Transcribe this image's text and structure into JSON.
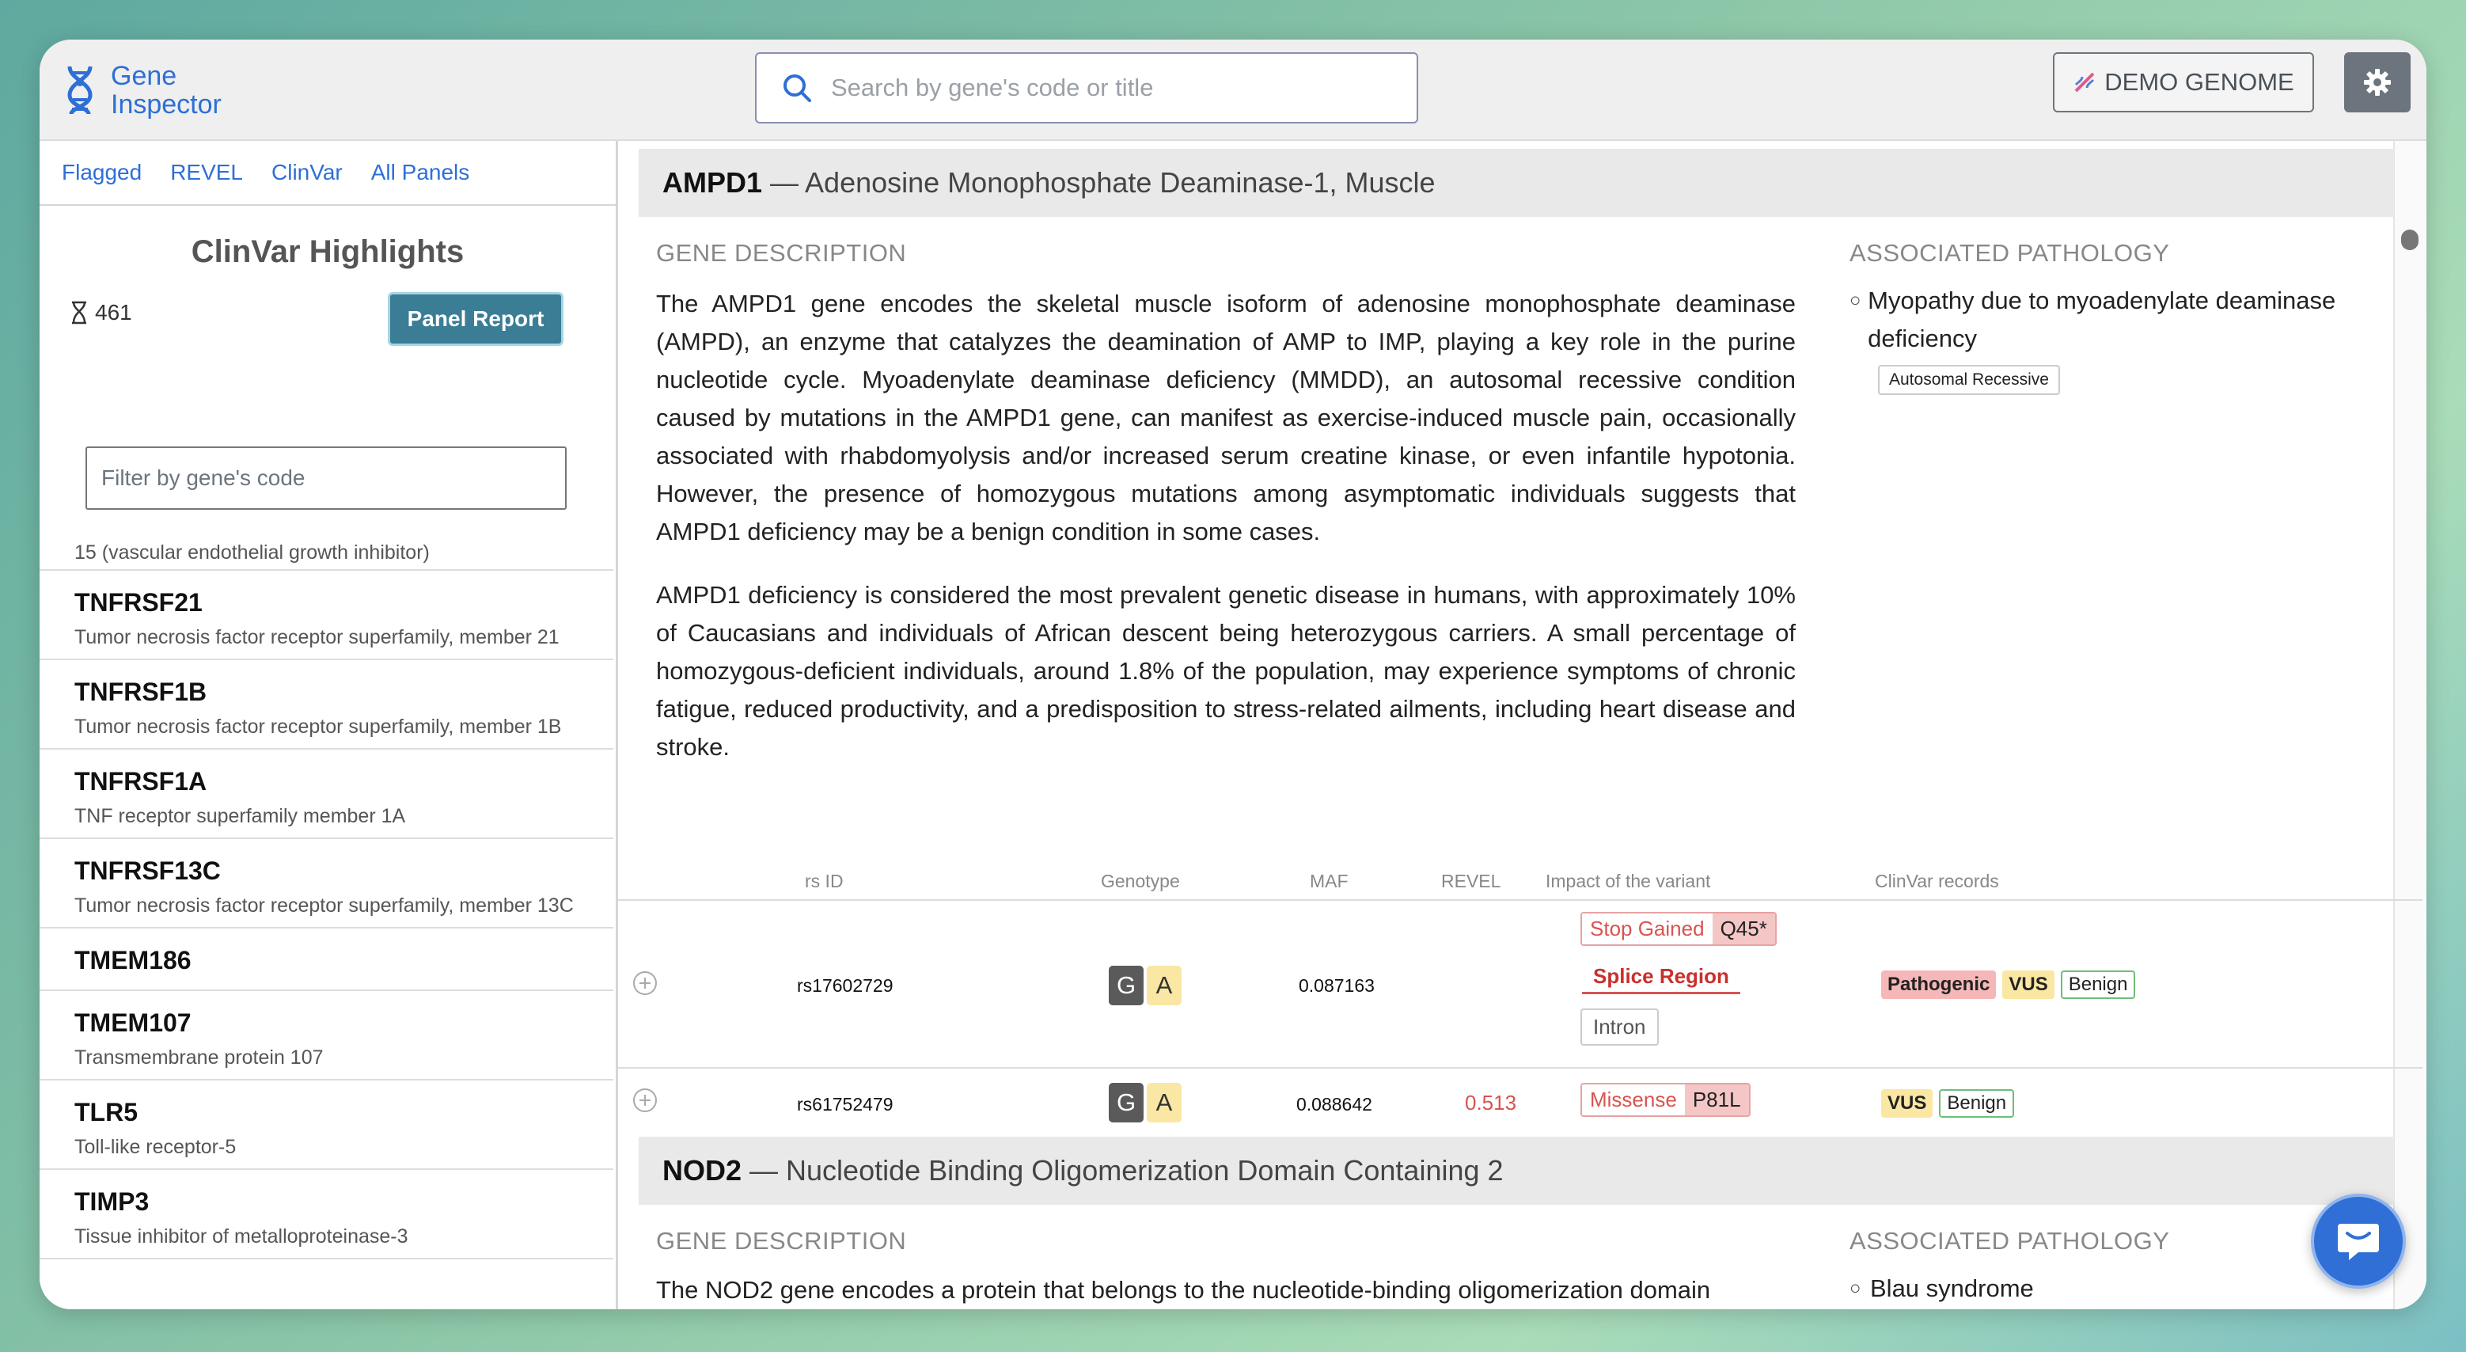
{
  "app": {
    "name_line1": "Gene",
    "name_line2": "Inspector"
  },
  "search": {
    "placeholder": "Search by gene's code or title"
  },
  "header": {
    "demo_label": "DEMO GENOME"
  },
  "sidebar": {
    "tabs": [
      "Flagged",
      "REVEL",
      "ClinVar",
      "All Panels"
    ],
    "title": "ClinVar Highlights",
    "count": "461",
    "panel_report": "Panel Report",
    "filter_placeholder": "Filter by gene's code",
    "cut_item": "15 (vascular endothelial growth inhibitor)",
    "genes": [
      {
        "code": "TNFRSF21",
        "name": "Tumor necrosis factor receptor superfamily, member 21"
      },
      {
        "code": "TNFRSF1B",
        "name": "Tumor necrosis factor receptor superfamily, member 1B"
      },
      {
        "code": "TNFRSF1A",
        "name": "TNF receptor superfamily member 1A"
      },
      {
        "code": "TNFRSF13C",
        "name": "Tumor necrosis factor receptor superfamily, member 13C"
      },
      {
        "code": "TMEM186",
        "name": ""
      },
      {
        "code": "TMEM107",
        "name": "Transmembrane protein 107"
      },
      {
        "code": "TLR5",
        "name": "Toll-like receptor-5"
      },
      {
        "code": "TIMP3",
        "name": "Tissue inhibitor of metalloproteinase-3"
      }
    ]
  },
  "gene1": {
    "code": "AMPD1",
    "title": "— Adenosine Monophosphate Deaminase-1, Muscle",
    "desc_label": "GENE DESCRIPTION",
    "path_label": "ASSOCIATED PATHOLOGY",
    "desc_p1": "The AMPD1 gene encodes the skeletal muscle isoform of adenosine monophosphate deaminase (AMPD), an enzyme that catalyzes the deamination of AMP to IMP, playing a key role in the purine nucleotide cycle. Myoadenylate deaminase deficiency (MMDD), an autosomal recessive condition caused by mutations in the AMPD1 gene, can manifest as exercise-induced muscle pain, occasionally associated with rhabdomyolysis and/or increased serum creatine kinase, or even infantile hypotonia. However, the presence of homozygous mutations among asymptomatic individuals suggests that AMPD1 deficiency may be a benign condition in some cases.",
    "desc_p2": "AMPD1 deficiency is considered the most prevalent genetic disease in humans, with approximately 10% of Caucasians and individuals of African descent being heterozygous carriers. A small percentage of homozygous-deficient individuals, around 1.8% of the population, may experience symptoms of chronic fatigue, reduced productivity, and a predisposition to stress-related ailments, including heart disease and stroke.",
    "pathology": "Myopathy due to myoadenylate deaminase deficiency",
    "inheritance": "Autosomal Recessive"
  },
  "table": {
    "headers": {
      "rsid": "rs ID",
      "genotype": "Genotype",
      "maf": "MAF",
      "revel": "REVEL",
      "impact": "Impact of the variant",
      "clinvar": "ClinVar records"
    },
    "rows": [
      {
        "rsid": "rs17602729",
        "g1": "G",
        "g2": "A",
        "maf": "0.087163",
        "revel": "",
        "impact1": "Stop Gained",
        "aa1": "Q45*",
        "impact2": "Splice Region",
        "impact3": "Intron",
        "cv1": "Pathogenic",
        "cv2": "VUS",
        "cv3": "Benign"
      },
      {
        "rsid": "rs61752479",
        "g1": "G",
        "g2": "A",
        "maf": "0.088642",
        "revel": "0.513",
        "impact1": "Missense",
        "aa1": "P81L",
        "cv1": "VUS",
        "cv2": "Benign"
      }
    ]
  },
  "gene2": {
    "code": "NOD2",
    "title": "— Nucleotide Binding Oligomerization Domain Containing 2",
    "desc_label": "GENE DESCRIPTION",
    "path_label": "ASSOCIATED PATHOLOGY",
    "desc_start": "The NOD2 gene encodes a protein that belongs to the nucleotide-binding oligomerization domain",
    "pathology": "Blau syndrome"
  },
  "colors": {
    "brand": "#2d6fd6",
    "panel_button": "#3a7d95",
    "pathogenic": "#f5b7b7",
    "vus": "#f9e7a3"
  }
}
